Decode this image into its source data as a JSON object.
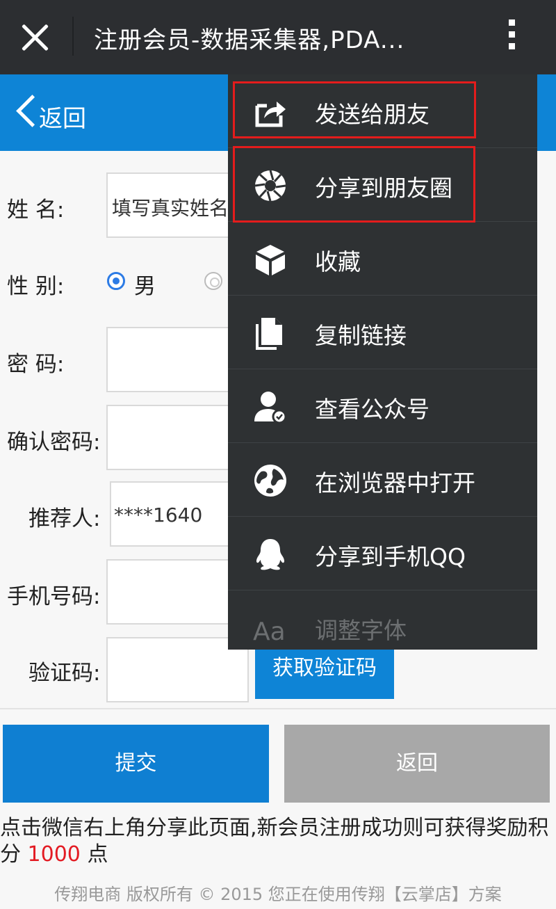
{
  "topbar": {
    "title": "注册会员-数据采集器,PDA..."
  },
  "header": {
    "back_label": "返回"
  },
  "form": {
    "name_label": "姓      名:",
    "name_placeholder": "填写真实姓名",
    "gender_label": "性      别:",
    "gender_male": "男",
    "password_label": "密      码:",
    "confirm_label": "确认密码:",
    "referrer_label": "推荐人:",
    "referrer_value": "****1640",
    "phone_label": "手机号码:",
    "code_label": "验证码:",
    "get_code_button": "获取验证码"
  },
  "buttons": {
    "submit": "提交",
    "return": "返回"
  },
  "notice": {
    "text_before": "点击微信右上角分享此页面,新会员注册成功则可获得奖励积分 ",
    "points": "1000",
    "text_after": " 点"
  },
  "footer": {
    "text": "传翔电商 版权所有 © 2015 您正在使用传翔【云掌店】方案"
  },
  "menu": {
    "items": [
      {
        "label": "发送给朋友",
        "icon": "share-forward-icon"
      },
      {
        "label": "分享到朋友圈",
        "icon": "moments-aperture-icon"
      },
      {
        "label": "收藏",
        "icon": "cube-icon"
      },
      {
        "label": "复制链接",
        "icon": "copy-document-icon"
      },
      {
        "label": "查看公众号",
        "icon": "official-account-icon"
      },
      {
        "label": "在浏览器中打开",
        "icon": "globe-icon"
      },
      {
        "label": "分享到手机QQ",
        "icon": "qq-penguin-icon"
      },
      {
        "label": "调整字体",
        "icon": "font-size-icon"
      }
    ]
  },
  "colors": {
    "topbar_bg": "#2c2e31",
    "header_blue": "#0e84d6",
    "menu_bg": "#2e3133",
    "highlight_red": "#e41c1c",
    "points_red": "#e31b23",
    "return_gray": "#a8a8a8"
  }
}
